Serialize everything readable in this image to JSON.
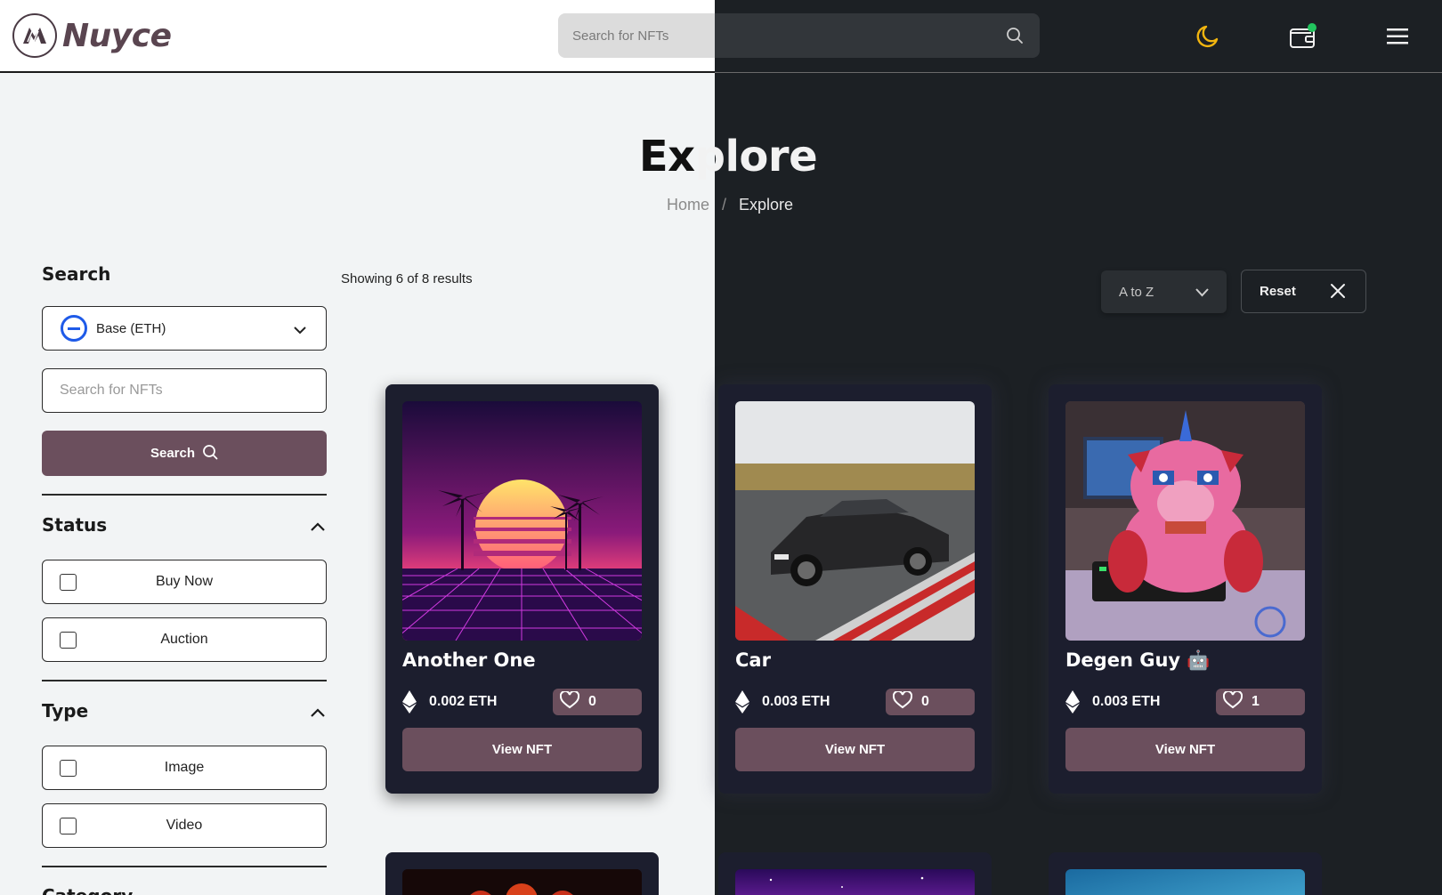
{
  "header": {
    "brand": "Nuyce",
    "search_placeholder": "Search for NFTs"
  },
  "hero": {
    "title_dark": "Ex",
    "title_light": "plore",
    "breadcrumb_home": "Home",
    "breadcrumb_sep": "/",
    "breadcrumb_current": "Explore"
  },
  "sidebar": {
    "search_heading": "Search",
    "chain_label": "Base (ETH)",
    "search_placeholder": "Search for NFTs",
    "search_button": "Search",
    "status_heading": "Status",
    "status_options": [
      "Buy Now",
      "Auction"
    ],
    "type_heading": "Type",
    "type_options": [
      "Image",
      "Video"
    ],
    "category_heading": "Category"
  },
  "results": {
    "showing": "Showing 6 of 8 results",
    "sort_value": "A to Z",
    "reset_label": "Reset"
  },
  "cards": [
    {
      "name": "Another One",
      "price": "0.002 ETH",
      "likes": "0",
      "button": "View NFT"
    },
    {
      "name": "Car",
      "price": "0.003 ETH",
      "likes": "0",
      "button": "View NFT"
    },
    {
      "name": "Degen Guy 🤖",
      "price": "0.003 ETH",
      "likes": "1",
      "button": "View NFT"
    }
  ],
  "colors": {
    "accent": "#6b4f5d",
    "card_bg": "#1c1e2e",
    "dark_bg": "#1c2024",
    "light_bg": "#f2f4f5",
    "moon": "#f2b50f",
    "chain_blue": "#1e5ae8",
    "notify_green": "#22c55e"
  }
}
